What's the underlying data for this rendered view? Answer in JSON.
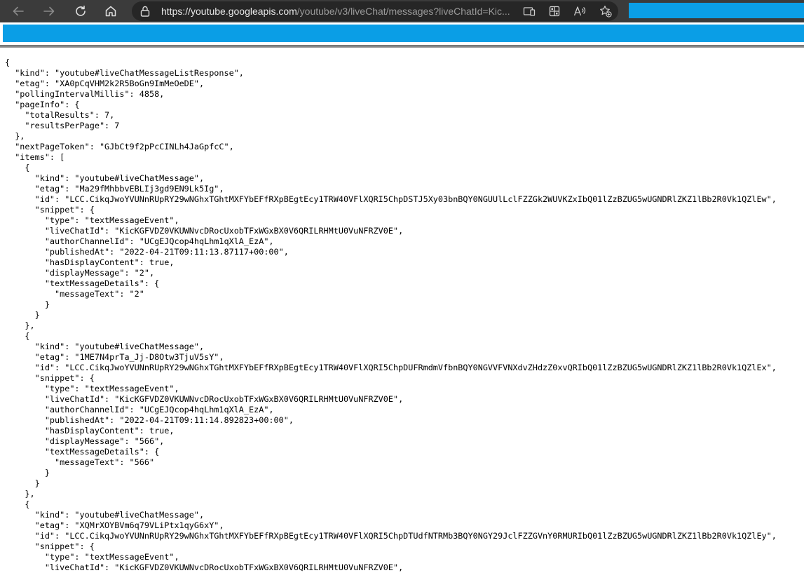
{
  "browser": {
    "url_host": "https://youtube.googleapis.com",
    "url_rest": "/youtube/v3/liveChat/messages?liveChatId=Kic...",
    "icons": [
      "back-icon",
      "forward-icon",
      "refresh-icon",
      "home-icon",
      "lock-icon",
      "reader-view-icon",
      "apps-icon",
      "read-aloud-icon",
      "favorites-add-icon"
    ],
    "accent": "#0a9ee6"
  },
  "response_lines": [
    "{",
    "  \"kind\": \"youtube#liveChatMessageListResponse\",",
    "  \"etag\": \"XA0pCqVHM2k2R5BoGn9ImMeOeDE\",",
    "  \"pollingIntervalMillis\": 4858,",
    "  \"pageInfo\": {",
    "    \"totalResults\": 7,",
    "    \"resultsPerPage\": 7",
    "  },",
    "  \"nextPageToken\": \"GJbCt9f2pPcCINLh4JaGpfcC\",",
    "  \"items\": [",
    "    {",
    "      \"kind\": \"youtube#liveChatMessage\",",
    "      \"etag\": \"Ma29fMhbbvEBLIj3gd9EN9Lk5Ig\",",
    "      \"id\": \"LCC.CikqJwoYVUNnRUpRY29wNGhxTGhtMXFYbEFfRXpBEgtEcy1TRW40VFlXQRI5ChpDSTJ5Xy03bnBQY0NGUUlLclFZZGk2WUVKZxIbQ01lZzBZUG5wUGNDRlZKZ1lBb2R0Vk1QZlEw\",",
    "      \"snippet\": {",
    "        \"type\": \"textMessageEvent\",",
    "        \"liveChatId\": \"KicKGFVDZ0VKUWNvcDRocUxobTFxWGxBX0V6QRILRHMtU0VuNFRZV0E\",",
    "        \"authorChannelId\": \"UCgEJQcop4hqLhm1qXlA_EzA\",",
    "        \"publishedAt\": \"2022-04-21T09:11:13.87117+00:00\",",
    "        \"hasDisplayContent\": true,",
    "        \"displayMessage\": \"2\",",
    "        \"textMessageDetails\": {",
    "          \"messageText\": \"2\"",
    "        }",
    "      }",
    "    },",
    "    {",
    "      \"kind\": \"youtube#liveChatMessage\",",
    "      \"etag\": \"1ME7N4prTa_Jj-D8Otw3TjuV5sY\",",
    "      \"id\": \"LCC.CikqJwoYVUNnRUpRY29wNGhxTGhtMXFYbEFfRXpBEgtEcy1TRW40VFlXQRI5ChpDUFRmdmVfbnBQY0NGVVFVNXdvZHdzZ0xvQRIbQ01lZzBZUG5wUGNDRlZKZ1lBb2R0Vk1QZlEx\",",
    "      \"snippet\": {",
    "        \"type\": \"textMessageEvent\",",
    "        \"liveChatId\": \"KicKGFVDZ0VKUWNvcDRocUxobTFxWGxBX0V6QRILRHMtU0VuNFRZV0E\",",
    "        \"authorChannelId\": \"UCgEJQcop4hqLhm1qXlA_EzA\",",
    "        \"publishedAt\": \"2022-04-21T09:11:14.892823+00:00\",",
    "        \"hasDisplayContent\": true,",
    "        \"displayMessage\": \"566\",",
    "        \"textMessageDetails\": {",
    "          \"messageText\": \"566\"",
    "        }",
    "      }",
    "    },",
    "    {",
    "      \"kind\": \"youtube#liveChatMessage\",",
    "      \"etag\": \"XQMrXOYBVm6q79VLiPtx1qyG6xY\",",
    "      \"id\": \"LCC.CikqJwoYVUNnRUpRY29wNGhxTGhtMXFYbEFfRXpBEgtEcy1TRW40VFlXQRI5ChpDTUdfNTRMb3BQY0NGY29JclFZZGVnY0RMURIbQ01lZzBZUG5wUGNDRlZKZ1lBb2R0Vk1QZlEy\",",
    "      \"snippet\": {",
    "        \"type\": \"textMessageEvent\",",
    "        \"liveChatId\": \"KicKGFVDZ0VKUWNvcDRocUxobTFxWGxBX0V6QRILRHMtU0VuNFRZV0E\","
  ]
}
